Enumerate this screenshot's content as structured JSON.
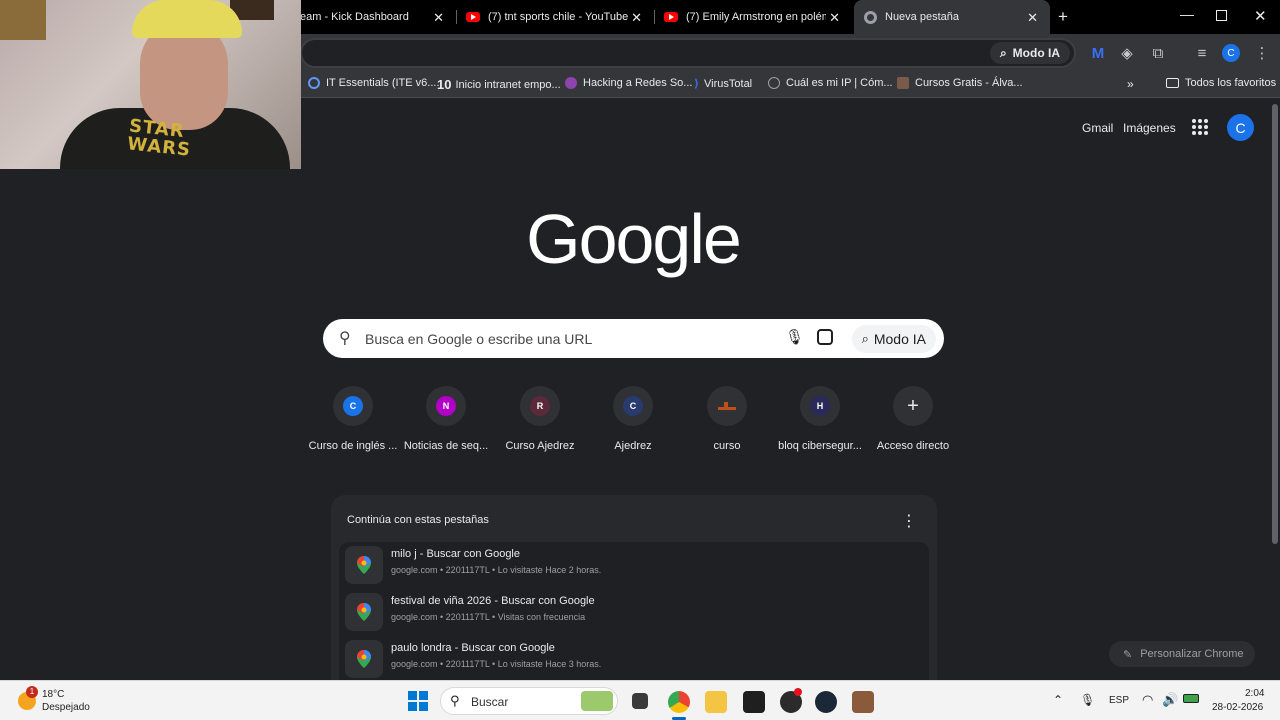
{
  "tabs": [
    {
      "title": "eam - Kick Dashboard",
      "icon": "kick-icon"
    },
    {
      "title": "(7) tnt sports chile - YouTube",
      "icon": "youtube-icon"
    },
    {
      "title": "(7) Emily Armstrong en polémic",
      "icon": "youtube-icon"
    },
    {
      "title": "Nueva pestaña",
      "icon": "chrome-icon"
    }
  ],
  "toolbar": {
    "modo_ia": "Modo IA",
    "profile_letter": "C"
  },
  "bookmarks": [
    {
      "label": "IT Essentials (ITE v6....",
      "color": "#5e97f6"
    },
    {
      "label": "Inicio intranet empo...",
      "color": "#ffffff"
    },
    {
      "label": "Hacking a Redes So...",
      "color": "#8e44ad"
    },
    {
      "label": "VirusTotal",
      "color": "#3a6df0"
    },
    {
      "label": "Cuál es mi IP | Cóm...",
      "color": "#9aa0a6"
    },
    {
      "label": "Cursos Gratis - Álva...",
      "color": "#7a5a4a"
    }
  ],
  "bookmarks_all": "Todos los favoritos",
  "header": {
    "gmail": "Gmail",
    "images": "Imágenes",
    "profile_letter": "C"
  },
  "logo": "Google",
  "search": {
    "placeholder": "Busca en Google o escribe una URL",
    "modo_ia": "Modo IA"
  },
  "shortcuts": [
    {
      "letter": "C",
      "label": "Curso de inglés ...",
      "color": "#1a73e8"
    },
    {
      "letter": "N",
      "label": "Noticias de seq...",
      "color": "#b000c8"
    },
    {
      "letter": "R",
      "label": "Curso Ajedrez",
      "color": "#5a2a3a"
    },
    {
      "letter": "C",
      "label": "Ajedrez",
      "color": "#283a6e"
    },
    {
      "letter": "",
      "label": "curso",
      "color": "#c0501a"
    },
    {
      "letter": "H",
      "label": "bloq cibersegur...",
      "color": "#2a2a5a"
    },
    {
      "letter": "+",
      "label": "Acceso directo",
      "color": "#303134"
    }
  ],
  "continue": {
    "title": "Continúa con estas pestañas",
    "items": [
      {
        "title": "milo j - Buscar con Google",
        "sub": "google.com • 2201117TL • Lo visitaste Hace 2 horas."
      },
      {
        "title": "festival de viña 2026 - Buscar con Google",
        "sub": "google.com • 2201117TL • Visitas con frecuencia"
      },
      {
        "title": "paulo londra - Buscar con Google",
        "sub": "google.com • 2201117TL • Lo visitaste Hace 3 horas."
      }
    ]
  },
  "customize": "Personalizar Chrome",
  "taskbar": {
    "weather_temp": "18°C",
    "weather_desc": "Despejado",
    "weather_badge": "1",
    "search": "Buscar",
    "lang": "ESP",
    "time": "2:04",
    "date": "28-02-2026"
  },
  "webcam": {
    "shirt_text": "STAR WARS"
  }
}
